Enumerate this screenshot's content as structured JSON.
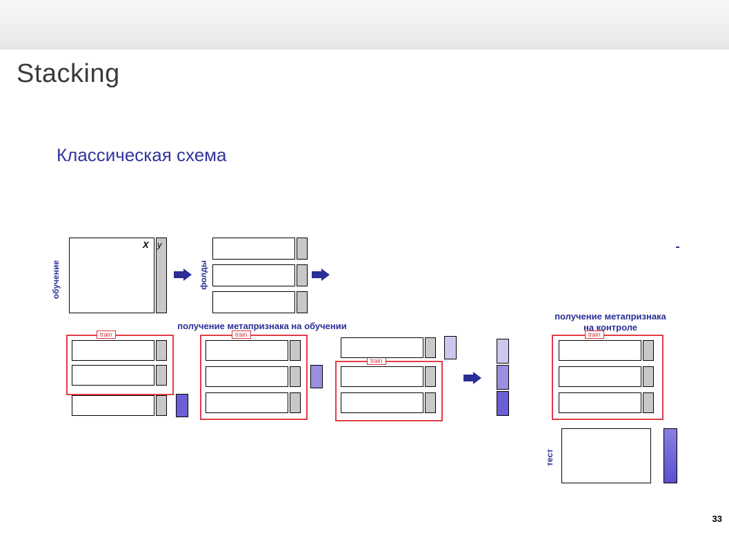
{
  "title": "Stacking",
  "subtitle": "Классическая схема",
  "page_number": "33",
  "labels": {
    "training_v": "обучение",
    "folds_v": "фолды",
    "test_v": "тест",
    "x": "X",
    "y": "y",
    "train_tag": "train",
    "caption_train_meta": "получение метапризнака на обучении",
    "caption_test_meta_1": "получение метапризнака",
    "caption_test_meta_2": "на контроле"
  },
  "colors": {
    "red": "#e23b43",
    "navy": "#2a2e95",
    "grey": "#c8c8c8",
    "violet_light": "#cfc6ef",
    "violet_mid": "#9a8fe2",
    "violet_dark": "#6b5fd6"
  }
}
